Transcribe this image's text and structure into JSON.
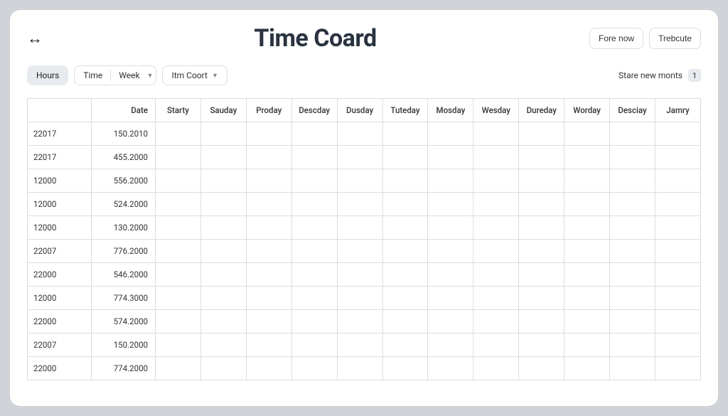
{
  "header": {
    "title": "Time Coard",
    "actions": {
      "primary": "Fore now",
      "secondary": "Trebcute"
    }
  },
  "toolbar": {
    "hours_label": "Hours",
    "time_label": "Time",
    "week_label": "Week",
    "item_coort_label": "Itm Coort",
    "right_label": "Stare new monts",
    "badge_value": "1"
  },
  "table": {
    "headers": [
      "",
      "Date",
      "Starty",
      "Sauday",
      "Proday",
      "Descday",
      "Dusday",
      "Tuteday",
      "Mosday",
      "Wesday",
      "Dureday",
      "Worday",
      "Desciay",
      "Jamry"
    ],
    "rows": [
      {
        "c0": "22017",
        "c1": "150.2010"
      },
      {
        "c0": "22017",
        "c1": "455.2000"
      },
      {
        "c0": "12000",
        "c1": "556.2000"
      },
      {
        "c0": "12000",
        "c1": "524.2000"
      },
      {
        "c0": "12000",
        "c1": "130.2000"
      },
      {
        "c0": "22007",
        "c1": "776.2000"
      },
      {
        "c0": "22000",
        "c1": "546.2000"
      },
      {
        "c0": "12000",
        "c1": "774.3000"
      },
      {
        "c0": "22000",
        "c1": "574.2000"
      },
      {
        "c0": "22007",
        "c1": "150.2000"
      },
      {
        "c0": "22000",
        "c1": "774.2000"
      }
    ]
  }
}
